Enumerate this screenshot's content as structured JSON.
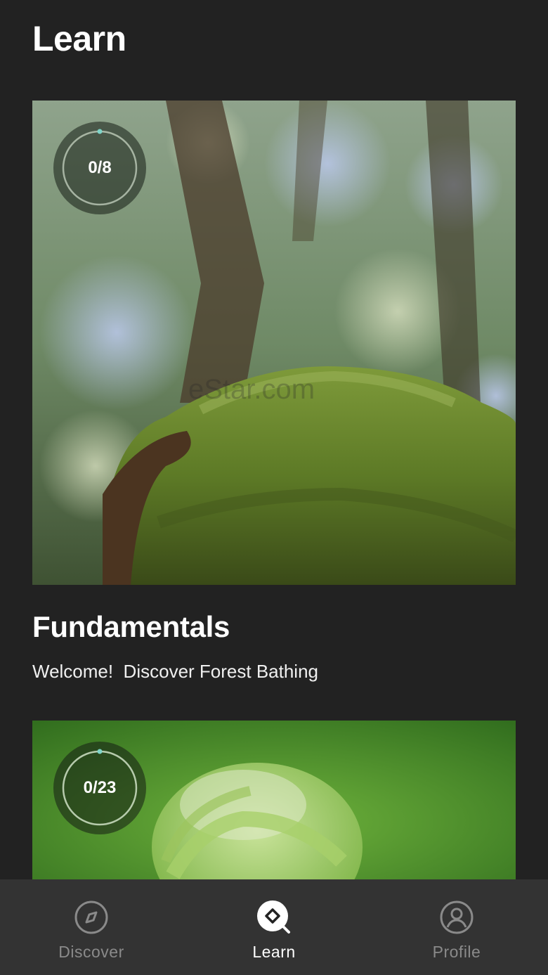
{
  "header": {
    "title": "Learn"
  },
  "cards": [
    {
      "progress": "0/8",
      "title": "Fundamentals",
      "subtitle": "Welcome!  Discover Forest Bathing",
      "image": "mossy-tree-branch"
    },
    {
      "progress": "0/23",
      "image": "unfurling-fern"
    }
  ],
  "watermark": "eStar.com",
  "bottom_nav": {
    "items": [
      {
        "label": "Discover",
        "icon": "compass-icon",
        "active": false
      },
      {
        "label": "Learn",
        "icon": "learn-icon",
        "active": true
      },
      {
        "label": "Profile",
        "icon": "profile-icon",
        "active": false
      }
    ]
  },
  "colors": {
    "background": "#222222",
    "nav_background": "#333333",
    "ring_accent": "#7fd4c8",
    "active_label": "#ffffff",
    "inactive_label": "#8a8a8a"
  }
}
